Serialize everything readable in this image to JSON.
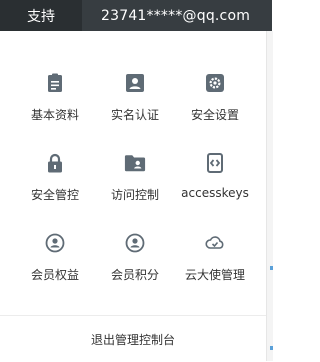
{
  "header": {
    "support_label": "支持",
    "account_email": "23741*****@qq.com"
  },
  "menu": {
    "items": [
      {
        "label": "基本资料",
        "icon": "clipboard-icon"
      },
      {
        "label": "实名认证",
        "icon": "id-card-icon"
      },
      {
        "label": "安全设置",
        "icon": "gear-icon"
      },
      {
        "label": "安全管控",
        "icon": "lock-icon"
      },
      {
        "label": "访问控制",
        "icon": "folder-user-icon"
      },
      {
        "label": "accesskeys",
        "icon": "key-code-icon"
      },
      {
        "label": "会员权益",
        "icon": "member-icon"
      },
      {
        "label": "会员积分",
        "icon": "member-points-icon"
      },
      {
        "label": "云大使管理",
        "icon": "cloud-ambassador-icon"
      }
    ],
    "logout_label": "退出管理控制台"
  },
  "colors": {
    "topbar": "#373d41",
    "topbar_active": "#2a2f32",
    "icon": "#5f6b75",
    "text": "#333333"
  }
}
